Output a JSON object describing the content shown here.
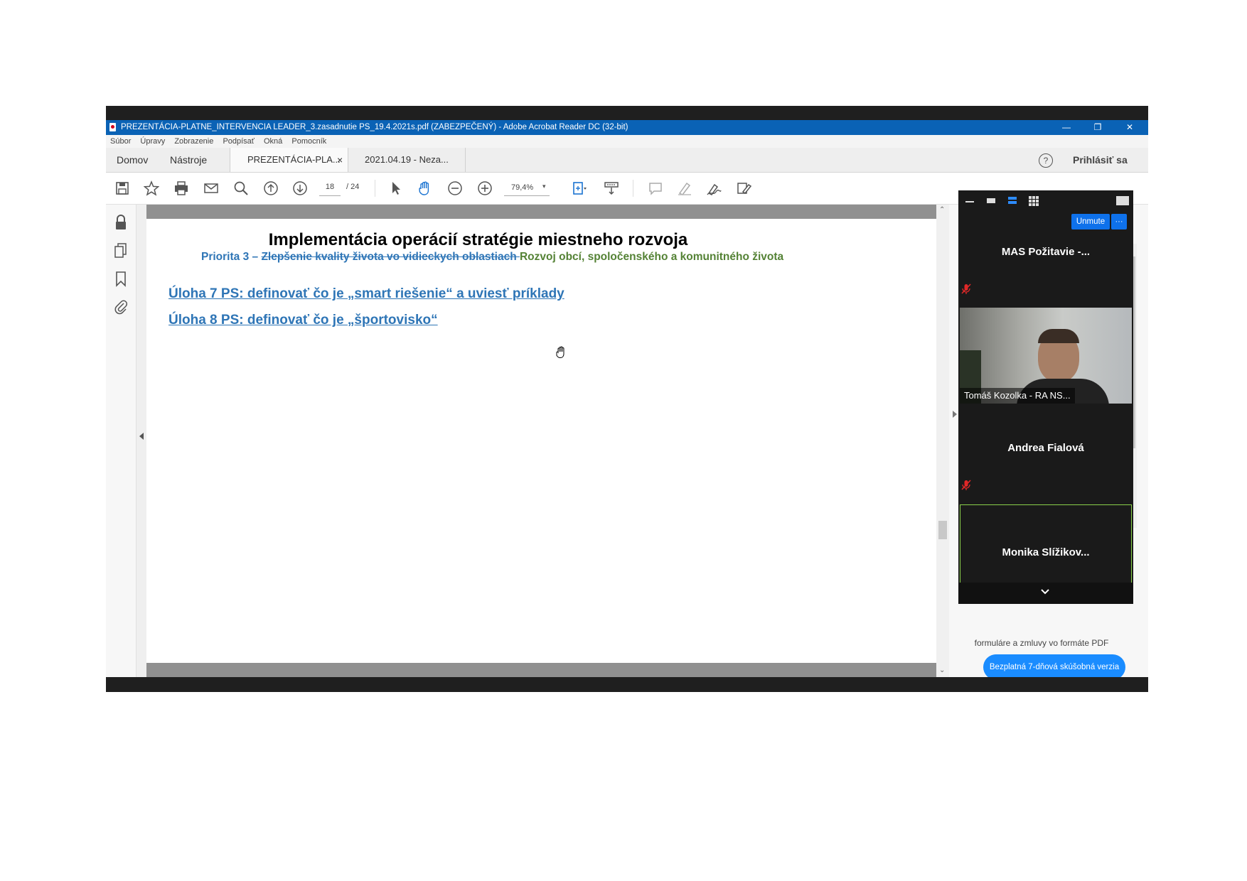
{
  "window": {
    "title": "PREZENTÁCIA-PLATNE_INTERVENCIA LEADER_3.zasadnutie PS_19.4.2021s.pdf (ZABEZPEČENÝ) - Adobe Acrobat Reader DC (32-bit)",
    "minimize_glyph": "—",
    "restore_glyph": "❐",
    "close_glyph": "✕"
  },
  "menu": [
    "Súbor",
    "Úpravy",
    "Zobrazenie",
    "Podpísať",
    "Okná",
    "Pomocník"
  ],
  "tabs": {
    "home": "Domov",
    "tools": "Nástroje",
    "doc1": "PREZENTÁCIA-PLA...",
    "doc1_close": "×",
    "doc2": "2021.04.19  - Neza...",
    "help_glyph": "?",
    "signin": "Prihlásiť sa"
  },
  "toolbar": {
    "page_current": "18",
    "page_total": "/ 24",
    "zoom": "79,4%"
  },
  "slide": {
    "title": "Implementácia operácií stratégie miestneho rozvoja",
    "priority_prefix": "Priorita 3 – ",
    "priority_struck": "Zlepšenie kvality života vo vidieckych oblastiach ",
    "priority_new": "Rozvoj obcí, spoločenského a komunitného života",
    "task1": "Úloha 7 PS: definovať čo je „smart riešenie“ a uviesť príklady",
    "task2": "Úloha 8 PS: definovať čo je „športovisko“"
  },
  "right_panel": {
    "promo_text": "formuláre a zmluvy vo formáte PDF",
    "trial_button": "Bezplatná 7-dňová skúšobná verzia"
  },
  "zoom": {
    "unmute_label": "Unmute",
    "more_label": "···",
    "participants": [
      {
        "name": "MAS  Požitavie  -...",
        "muted": true
      },
      {
        "name": "Tomáš Kozolka - RA NS...",
        "video": true
      },
      {
        "name": "Andrea Fialová",
        "muted": true
      },
      {
        "name": "Monika  Slížikov...",
        "active": true
      }
    ]
  },
  "colors": {
    "title_bar": "#0a62b5",
    "slide_blue": "#2e75b6",
    "slide_green": "#548235",
    "zoom_blue": "#0e71eb",
    "trial_button": "#1a8cff"
  }
}
